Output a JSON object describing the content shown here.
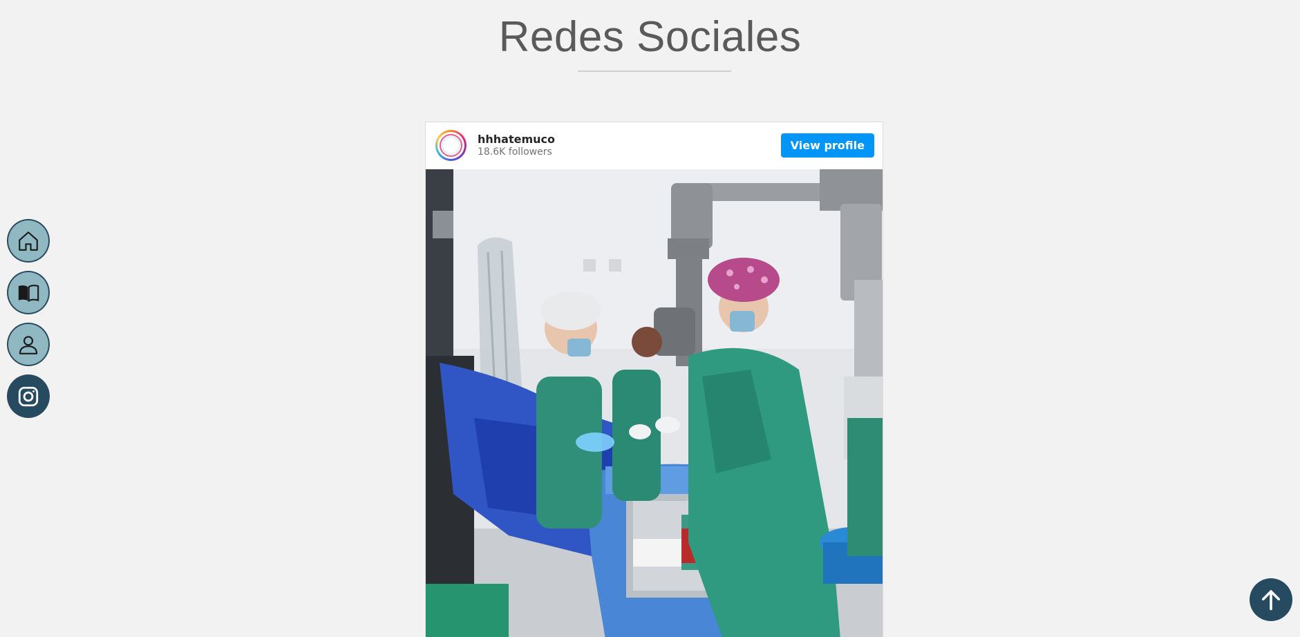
{
  "section": {
    "title": "Redes Sociales"
  },
  "side_nav": {
    "items": [
      {
        "icon": "home-icon",
        "active": false
      },
      {
        "icon": "book-icon",
        "active": false
      },
      {
        "icon": "user-icon",
        "active": false
      },
      {
        "icon": "instagram-icon",
        "active": true
      }
    ]
  },
  "instagram_embed": {
    "username": "hhhatemuco",
    "followers": "18.6K followers",
    "view_profile_label": "View profile",
    "photo": "operating-room-surgery-photo"
  },
  "scroll_top": {
    "icon": "arrow-up-icon"
  },
  "colors": {
    "background": "#f2f2f2",
    "nav_button": "#8fb8c2",
    "nav_active": "#264a60",
    "instagram_blue": "#0095f6",
    "title_text": "#5a5a5a"
  }
}
